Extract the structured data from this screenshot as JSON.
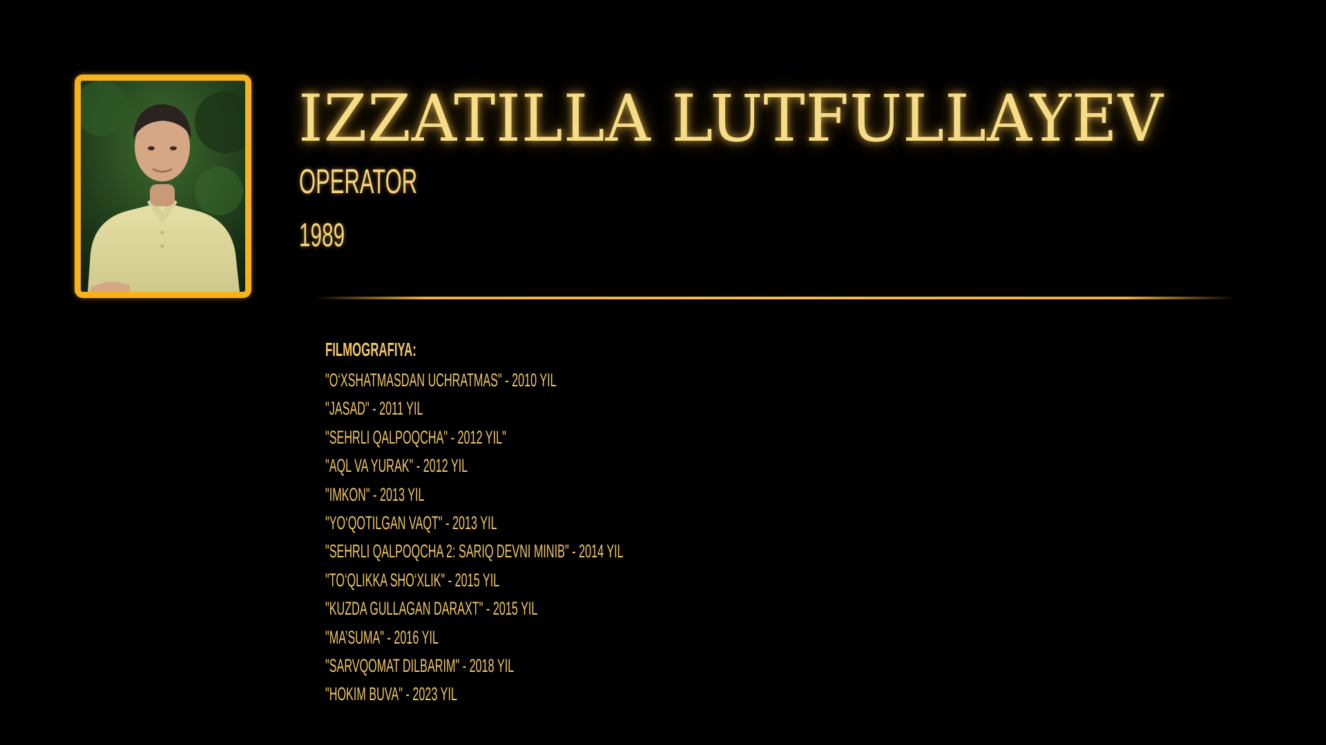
{
  "profile": {
    "name": "IZZATILLA LUTFULLAYEV",
    "role": "OPERATOR",
    "year": "1989"
  },
  "filmography": {
    "heading": "FILMOGRAFIYA:",
    "items": [
      "\"O‘XSHATMASDAN UCHRATMAS\" - 2010 YIL",
      "\"JASAD\" - 2011 YIL",
      "\"SEHRLI QALPOQCHA\" - 2012 YIL\"",
      "\"AQL VA YURAK\" - 2012 YIL",
      "\"IMKON\" - 2013 YIL",
      "\"YO‘QOTILGAN VAQT\" - 2013 YIL",
      "\"SEHRLI QALPOQCHA 2: SARIQ DEVNI MINIB\" - 2014 YIL",
      "\"TO‘QLIKKA SHO‘XLIK\" - 2015 YIL",
      "\"KUZDA GULLAGAN DARAXT\" - 2015 YIL",
      "\"MA’SUMA\" - 2016 YIL",
      "\"SARVQOMAT DILBARIM\" - 2018 YIL",
      "\"HOKIM BUVA\" - 2023 YIL"
    ]
  },
  "colors": {
    "background": "#000000",
    "frame": "#f7b21c",
    "title": "#f7dc88",
    "text": "#f2c862"
  }
}
